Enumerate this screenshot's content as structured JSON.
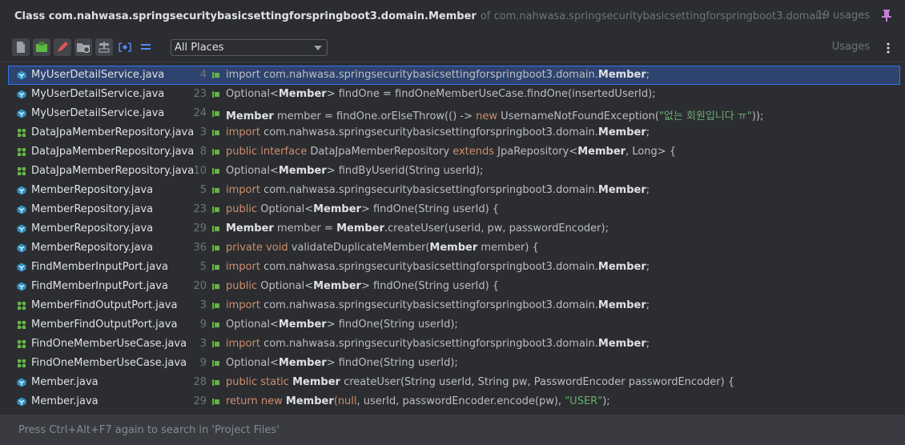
{
  "header": {
    "class_title": "Class com.nahwasa.springsecuritybasicsettingforspringboot3.domain.Member",
    "of_package": "of com.nahwasa.springsecuritybasicsettingforspringboot3.domain",
    "usage_count": "19 usages",
    "pin_icon": "pin-icon"
  },
  "toolbar": {
    "scope_value": "All Places",
    "usages_label": "Usages",
    "buttons": [
      "file-icon",
      "module-icon",
      "edit-icon",
      "folder-icon",
      "merge-icon",
      "preview-icon",
      "group-icon"
    ]
  },
  "colors": {
    "background": "#2b2d30",
    "selected_row": "#2e436e",
    "keyword": "#cf8e6d",
    "string": "#6aab73",
    "class_icon": "#3592c4",
    "interface_icon": "#62b543"
  },
  "results": [
    {
      "file": "MyUserDetailService.java",
      "icon": "class-file-icon",
      "line": "4",
      "code": [
        [
          "t",
          "import com.nahwasa.springsecuritybasicsettingforspringboot3.domain."
        ],
        [
          "b",
          "Member"
        ],
        [
          "t",
          ";"
        ]
      ]
    },
    {
      "file": "MyUserDetailService.java",
      "icon": "class-file-icon",
      "line": "23",
      "code": [
        [
          "t",
          "Optional<"
        ],
        [
          "b",
          "Member"
        ],
        [
          "t",
          "> findOne = findOneMemberUseCase.findOne(insertedUserId);"
        ]
      ]
    },
    {
      "file": "MyUserDetailService.java",
      "icon": "class-file-icon",
      "line": "24",
      "code": [
        [
          "b",
          "Member"
        ],
        [
          "t",
          " member = findOne.orElseThrow(() -> "
        ],
        [
          "k",
          "new"
        ],
        [
          "t",
          " UsernameNotFoundException("
        ],
        [
          "s",
          "\"없는 회원입니다 ㅠ\""
        ],
        [
          "t",
          "));"
        ]
      ]
    },
    {
      "file": "DataJpaMemberRepository.java",
      "icon": "interface-file-icon",
      "line": "3",
      "code": [
        [
          "k",
          "import"
        ],
        [
          "t",
          " com.nahwasa.springsecuritybasicsettingforspringboot3.domain."
        ],
        [
          "b",
          "Member"
        ],
        [
          "t",
          ";"
        ]
      ]
    },
    {
      "file": "DataJpaMemberRepository.java",
      "icon": "interface-file-icon",
      "line": "8",
      "code": [
        [
          "k",
          "public interface"
        ],
        [
          "t",
          " DataJpaMemberRepository "
        ],
        [
          "k",
          "extends"
        ],
        [
          "t",
          " JpaRepository<"
        ],
        [
          "b",
          "Member"
        ],
        [
          "t",
          ", Long> {"
        ]
      ]
    },
    {
      "file": "DataJpaMemberRepository.java",
      "icon": "interface-file-icon",
      "line": "10",
      "code": [
        [
          "t",
          "Optional<"
        ],
        [
          "b",
          "Member"
        ],
        [
          "t",
          "> findByUserid(String userId);"
        ]
      ]
    },
    {
      "file": "MemberRepository.java",
      "icon": "class-file-icon",
      "line": "5",
      "code": [
        [
          "k",
          "import"
        ],
        [
          "t",
          " com.nahwasa.springsecuritybasicsettingforspringboot3.domain."
        ],
        [
          "b",
          "Member"
        ],
        [
          "t",
          ";"
        ]
      ]
    },
    {
      "file": "MemberRepository.java",
      "icon": "class-file-icon",
      "line": "23",
      "code": [
        [
          "k",
          "public"
        ],
        [
          "t",
          " Optional<"
        ],
        [
          "b",
          "Member"
        ],
        [
          "t",
          "> findOne(String userId) {"
        ]
      ]
    },
    {
      "file": "MemberRepository.java",
      "icon": "class-file-icon",
      "line": "29",
      "code": [
        [
          "b",
          "Member"
        ],
        [
          "t",
          " member = "
        ],
        [
          "b",
          "Member"
        ],
        [
          "t",
          ".createUser(userid, pw, passwordEncoder);"
        ]
      ]
    },
    {
      "file": "MemberRepository.java",
      "icon": "class-file-icon",
      "line": "36",
      "code": [
        [
          "k",
          "private void"
        ],
        [
          "t",
          " validateDuplicateMember("
        ],
        [
          "b",
          "Member"
        ],
        [
          "t",
          " member) {"
        ]
      ]
    },
    {
      "file": "FindMemberInputPort.java",
      "icon": "class-file-icon",
      "line": "5",
      "code": [
        [
          "k",
          "import"
        ],
        [
          "t",
          " com.nahwasa.springsecuritybasicsettingforspringboot3.domain."
        ],
        [
          "b",
          "Member"
        ],
        [
          "t",
          ";"
        ]
      ]
    },
    {
      "file": "FindMemberInputPort.java",
      "icon": "class-file-icon",
      "line": "20",
      "code": [
        [
          "k",
          "public"
        ],
        [
          "t",
          " Optional<"
        ],
        [
          "b",
          "Member"
        ],
        [
          "t",
          "> findOne(String userId) {"
        ]
      ]
    },
    {
      "file": "MemberFindOutputPort.java",
      "icon": "interface-file-icon",
      "line": "3",
      "code": [
        [
          "k",
          "import"
        ],
        [
          "t",
          " com.nahwasa.springsecuritybasicsettingforspringboot3.domain."
        ],
        [
          "b",
          "Member"
        ],
        [
          "t",
          ";"
        ]
      ]
    },
    {
      "file": "MemberFindOutputPort.java",
      "icon": "interface-file-icon",
      "line": "9",
      "code": [
        [
          "t",
          "Optional<"
        ],
        [
          "b",
          "Member"
        ],
        [
          "t",
          "> findOne(String userId);"
        ]
      ]
    },
    {
      "file": "FindOneMemberUseCase.java",
      "icon": "interface-file-icon",
      "line": "3",
      "code": [
        [
          "k",
          "import"
        ],
        [
          "t",
          " com.nahwasa.springsecuritybasicsettingforspringboot3.domain."
        ],
        [
          "b",
          "Member"
        ],
        [
          "t",
          ";"
        ]
      ]
    },
    {
      "file": "FindOneMemberUseCase.java",
      "icon": "interface-file-icon",
      "line": "9",
      "code": [
        [
          "t",
          "Optional<"
        ],
        [
          "b",
          "Member"
        ],
        [
          "t",
          "> findOne(String userId);"
        ]
      ]
    },
    {
      "file": "Member.java",
      "icon": "class-file-icon",
      "line": "28",
      "code": [
        [
          "k",
          "public static"
        ],
        [
          "t",
          " "
        ],
        [
          "b",
          "Member"
        ],
        [
          "t",
          " createUser(String userId, String pw, PasswordEncoder passwordEncoder) {"
        ]
      ]
    },
    {
      "file": "Member.java",
      "icon": "class-file-icon",
      "line": "29",
      "code": [
        [
          "k",
          "return new"
        ],
        [
          "t",
          " "
        ],
        [
          "b",
          "Member"
        ],
        [
          "k",
          "(null"
        ],
        [
          "t",
          ", userId, passwordEncoder.encode(pw), "
        ],
        [
          "s",
          "\"USER\""
        ],
        [
          "t",
          ");"
        ]
      ]
    }
  ],
  "footer": {
    "hint": "Press Ctrl+Alt+F7 again to search in 'Project Files'"
  }
}
